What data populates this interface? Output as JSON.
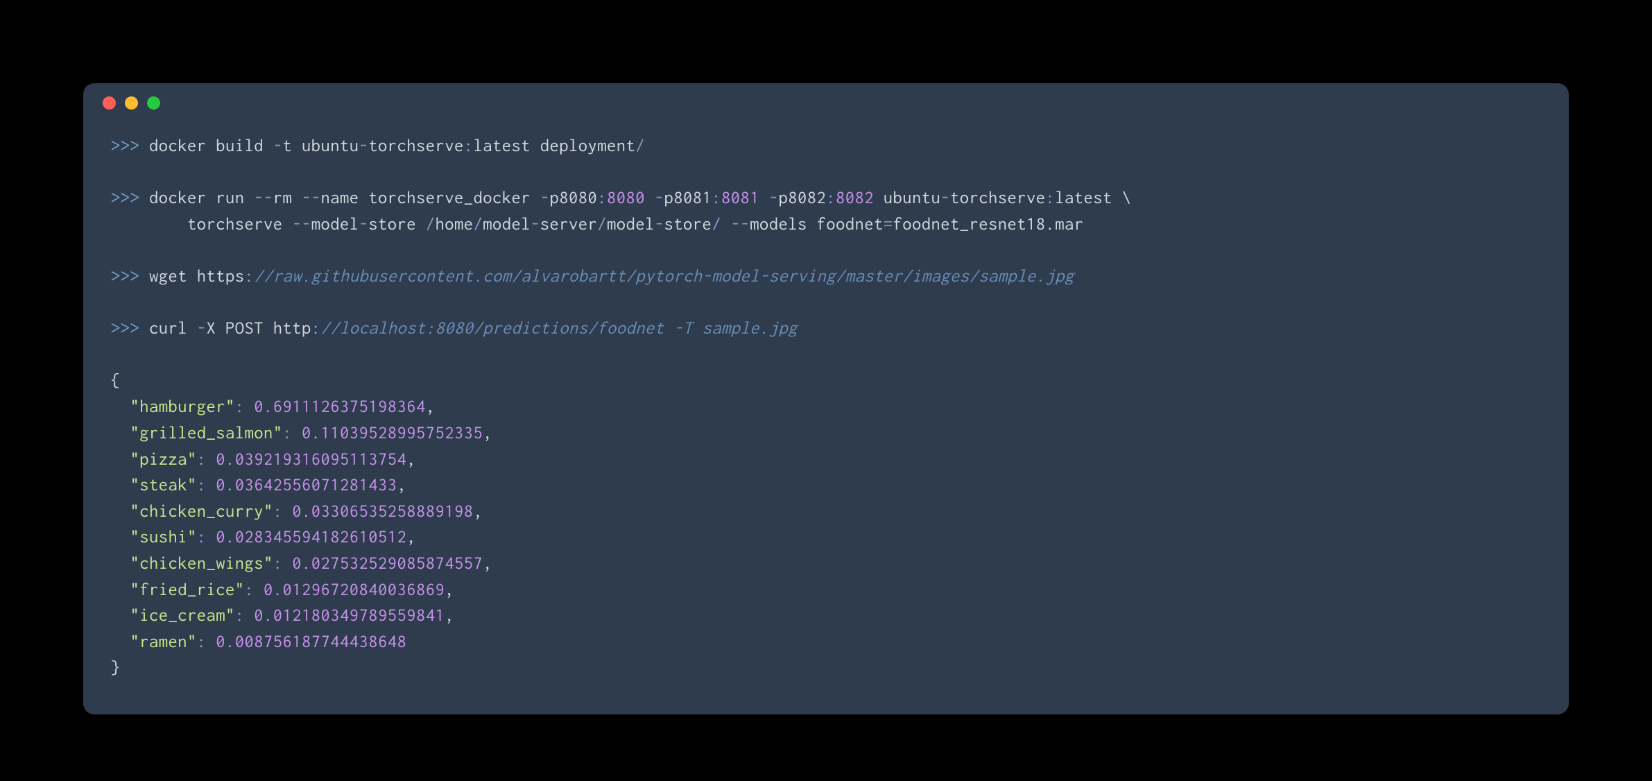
{
  "colors": {
    "bg": "#000000",
    "terminal_bg": "#2e3c4e",
    "red": "#ff5f56",
    "yellow": "#ffbd2e",
    "green": "#27c93f",
    "text": "#d0d7de",
    "prompt": "#7aa2c9",
    "numeric": "#c792ea",
    "comment": "#6a8cb5",
    "string": "#c3e88d"
  },
  "prompt": ">>>",
  "cmd1": {
    "prefix": " docker build ",
    "flag_t": "-",
    "t": "t ubuntu",
    "dash1": "-",
    "rest1": "torchserve",
    "colon1": ":",
    "rest2": "latest deployment",
    "slash": "/"
  },
  "cmd2": {
    "prefix": " docker run ",
    "ddash1": "--",
    "rm": "rm ",
    "ddash2": "--",
    "name": "name torchserve_docker ",
    "dash_p1": "-",
    "p1": "p8080",
    "colon1": ":",
    "port1": "8080",
    "sp1": " ",
    "dash_p2": "-",
    "p2": "p8081",
    "colon2": ":",
    "port2": "8081",
    "sp2": " ",
    "dash_p3": "-",
    "p3": "p8082",
    "colon3": ":",
    "port3": "8082",
    "sp3": " ubuntu",
    "dash_img": "-",
    "img": "torchserve",
    "colon4": ":",
    "tag": "latest \\",
    "indent": "        torchserve ",
    "ddash3": "--",
    "model": "model",
    "dash_ms": "-",
    "store": "store ",
    "slash1": "/",
    "home": "home",
    "slash2": "/",
    "model2": "model",
    "dash_srv": "-",
    "server": "server",
    "slash3": "/",
    "model3": "model",
    "dash_st": "-",
    "store2": "store",
    "slash4": "/",
    "sp4": " ",
    "ddash4": "--",
    "models": "models foodnet",
    "eq": "=",
    "mar": "foodnet_resnet18.mar"
  },
  "cmd3": {
    "prefix": " wget https",
    "colon": ":",
    "url": "//raw.githubusercontent.com/alvarobartt/pytorch-model-serving/master/images/sample.jpg"
  },
  "cmd4": {
    "prefix": " curl ",
    "dash_x": "-",
    "x": "X POST http",
    "colon": ":",
    "url": "//localhost:8080/predictions/foodnet -T sample.jpg"
  },
  "json_output": {
    "open": "{",
    "close": "}",
    "entries": [
      {
        "key": "\"hamburger\"",
        "val": "0.6911126375198364",
        "comma": ","
      },
      {
        "key": "\"grilled_salmon\"",
        "val": "0.11039528995752335",
        "comma": ","
      },
      {
        "key": "\"pizza\"",
        "val": "0.039219316095113754",
        "comma": ","
      },
      {
        "key": "\"steak\"",
        "val": "0.03642556071281433",
        "comma": ","
      },
      {
        "key": "\"chicken_curry\"",
        "val": "0.03306535258889198",
        "comma": ","
      },
      {
        "key": "\"sushi\"",
        "val": "0.028345594182610512",
        "comma": ","
      },
      {
        "key": "\"chicken_wings\"",
        "val": "0.027532529085874557",
        "comma": ","
      },
      {
        "key": "\"fried_rice\"",
        "val": "0.01296720840036869",
        "comma": ","
      },
      {
        "key": "\"ice_cream\"",
        "val": "0.012180349789559841",
        "comma": ","
      },
      {
        "key": "\"ramen\"",
        "val": "0.008756187744438648",
        "comma": ""
      }
    ]
  }
}
